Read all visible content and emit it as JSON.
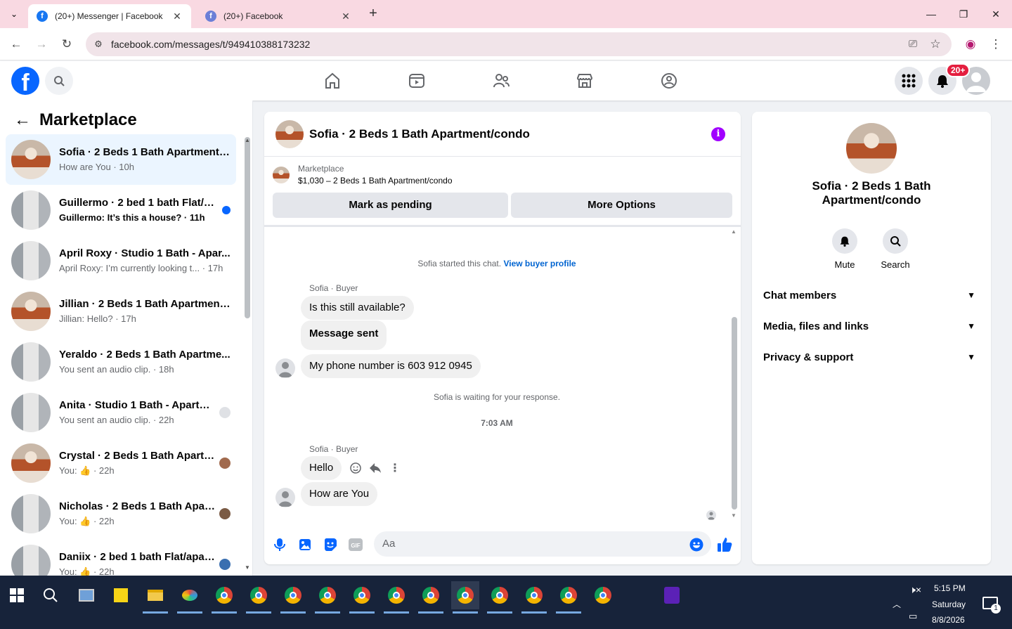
{
  "browser": {
    "tabs": [
      {
        "title": "(20+) Messenger | Facebook",
        "active": true
      },
      {
        "title": "(20+) Facebook",
        "active": false
      }
    ],
    "url": "facebook.com/messages/t/949410388173232"
  },
  "fb": {
    "notif_count": "20+",
    "brand_color": "#0866ff"
  },
  "sidebar": {
    "title": "Marketplace",
    "conversations": [
      {
        "name": "Sofia · 2 Beds 1 Bath Apartment/...",
        "snippet": "How are You · 10h",
        "selected": true,
        "unread": false
      },
      {
        "name": "Guillermo · 2 bed 1 bath Flat/a...",
        "snippet": "Guillermo: It’s this a house? · 11h",
        "selected": false,
        "unread": true
      },
      {
        "name": "April Roxy · Studio 1 Bath - Apar...",
        "snippet": "April Roxy: I’m currently looking t...  · 17h",
        "selected": false,
        "unread": false
      },
      {
        "name": "Jillian · 2 Beds 1 Bath Apartment...",
        "snippet": "Jillian: Hello? · 17h",
        "selected": false,
        "unread": false
      },
      {
        "name": "Yeraldo · 2 Beds 1 Bath Apartme...",
        "snippet": "You sent an audio clip. · 18h",
        "selected": false,
        "unread": false
      },
      {
        "name": "Anita · Studio 1 Bath - Apartm...",
        "snippet": "You sent an audio clip. · 22h",
        "selected": false,
        "unread": false
      },
      {
        "name": "Crystal · 2 Beds 1 Bath Apartm...",
        "snippet": "You: 👍 · 22h",
        "selected": false,
        "unread": false
      },
      {
        "name": "Nicholas · 2 Beds 1 Bath Apart...",
        "snippet": "You: 👍 · 22h",
        "selected": false,
        "unread": false
      },
      {
        "name": "Daniix · 2 bed 1 bath Flat/apar...",
        "snippet": "You: 👍 · 22h",
        "selected": false,
        "unread": false
      }
    ]
  },
  "chat": {
    "title": "Sofia · 2 Beds 1 Bath Apartment/condo",
    "listing_source": "Marketplace",
    "listing_desc": "$1,030 – 2 Beds 1 Bath Apartment/condo",
    "btn_pending": "Mark as pending",
    "btn_more": "More Options",
    "started_text": "Sofia started this chat.",
    "view_profile": "View buyer profile",
    "sender_label": "Sofia · Buyer",
    "messages1": [
      "Is this still available?",
      "Message sent",
      "My phone number is 603 912 0945"
    ],
    "waiting_text": "Sofia is waiting for your response.",
    "timestamp": "7:03 AM",
    "messages2": [
      "Hello",
      "How are You"
    ],
    "input_placeholder": "Aa"
  },
  "details": {
    "name_line1": "Sofia · 2 Beds 1 Bath",
    "name_line2": "Apartment/condo",
    "mute_label": "Mute",
    "search_label": "Search",
    "sections": [
      "Chat members",
      "Media, files and links",
      "Privacy & support"
    ]
  },
  "taskbar": {
    "time": "5:15 PM",
    "day": "Saturday",
    "date": "8/8/2026",
    "notif_count": "1"
  }
}
